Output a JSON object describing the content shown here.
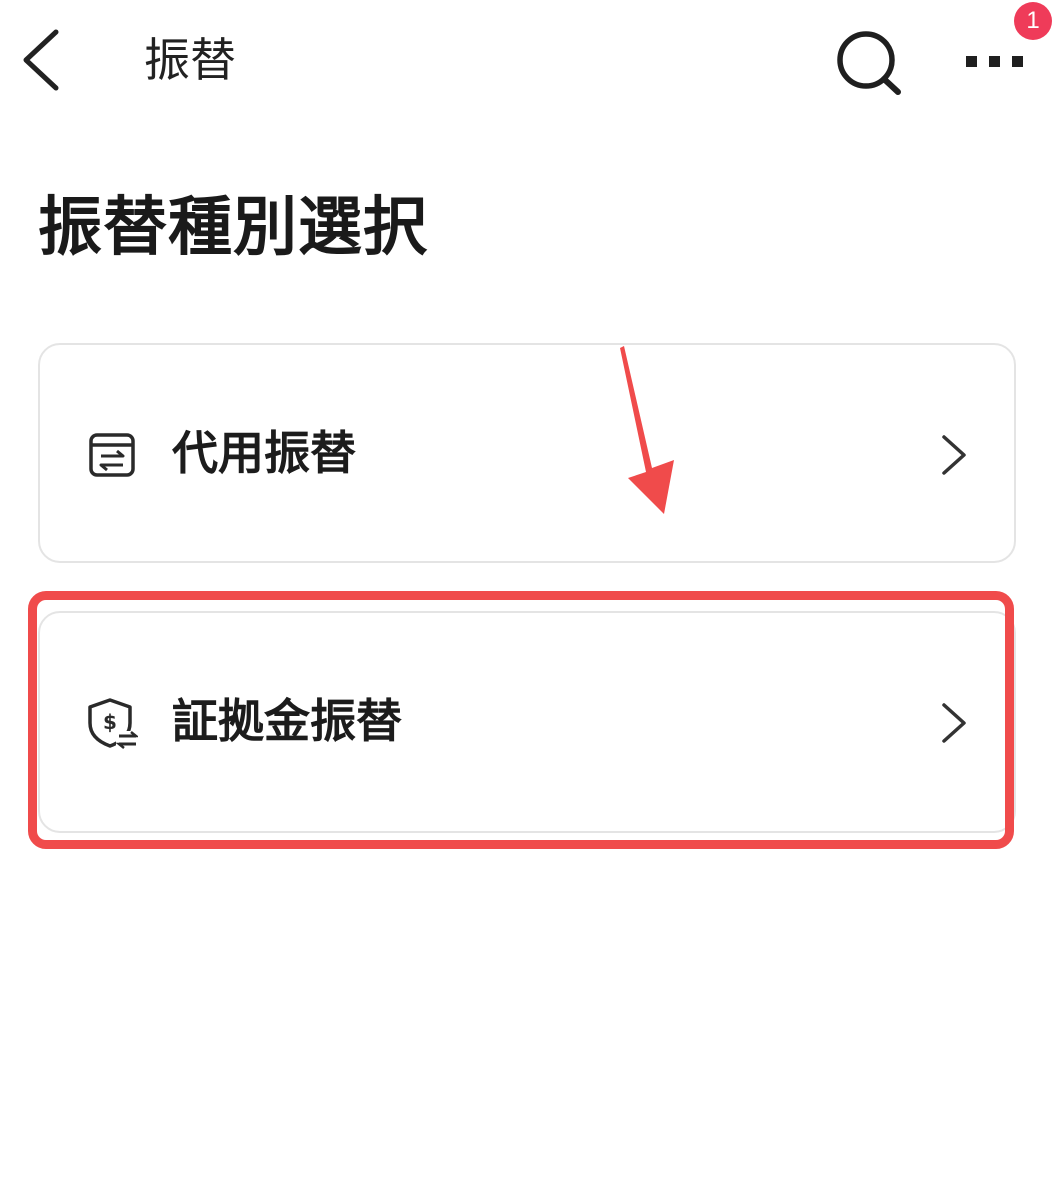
{
  "header": {
    "title": "振替",
    "back_icon": "chevron-left-icon",
    "search_icon": "search-icon",
    "more_icon": "more-horizontal-icon",
    "notification_badge": "1",
    "badge_color": "#ef3b59"
  },
  "page": {
    "heading": "振替種別選択"
  },
  "options": [
    {
      "label": "代用振替",
      "icon": "transfer-document-icon"
    },
    {
      "label": "証拠金振替",
      "icon": "shield-dollar-transfer-icon"
    }
  ],
  "annotations": {
    "highlight_color": "#f04b4b",
    "highlighted_option": "証拠金振替"
  }
}
